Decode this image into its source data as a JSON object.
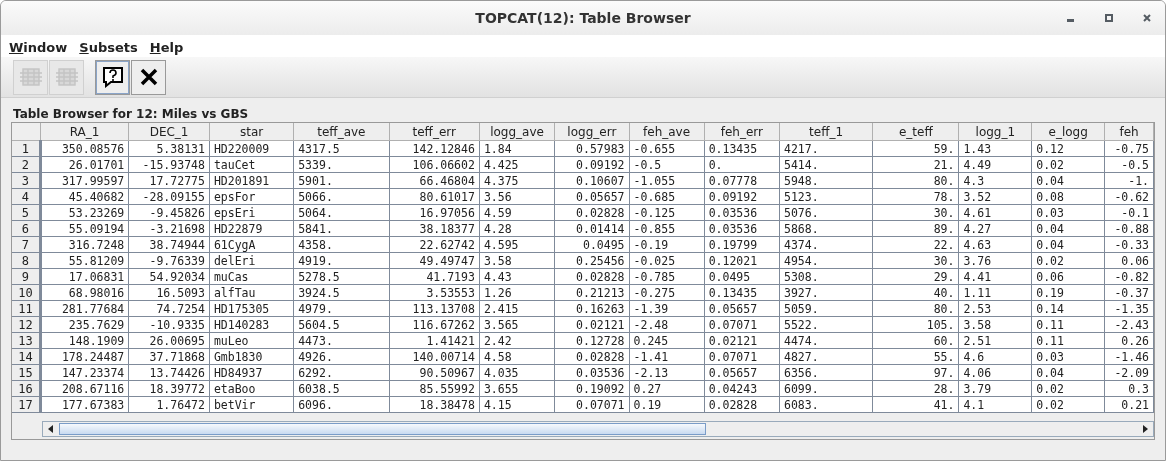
{
  "window": {
    "title": "TOPCAT(12): Table Browser"
  },
  "menu": [
    {
      "label": "Window"
    },
    {
      "label": "Subsets"
    },
    {
      "label": "Help"
    }
  ],
  "toolbar": [
    {
      "kind": "table",
      "disabled": true,
      "focused": false
    },
    {
      "kind": "table",
      "disabled": true,
      "focused": false
    },
    {
      "kind": "help",
      "disabled": false,
      "focused": true
    },
    {
      "kind": "close",
      "disabled": false,
      "focused": false
    }
  ],
  "heading": "Table Browser for 12: Miles vs GBS",
  "table": {
    "columns": [
      "RA_1",
      "DEC_1",
      "star",
      "teff_ave",
      "teff_err",
      "logg_ave",
      "logg_err",
      "feh_ave",
      "feh_err",
      "teff_1",
      "e_teff",
      "logg_1",
      "e_logg",
      "feh"
    ],
    "rows": [
      {
        "number": "1",
        "cells": [
          "350.08576",
          "5.38131",
          "HD220009",
          "4317.5",
          "142.12846",
          "1.84",
          "0.57983",
          "-0.655",
          "0.13435",
          "4217.",
          "59.",
          "1.43",
          "0.12",
          "-0.75"
        ]
      },
      {
        "number": "2",
        "cells": [
          "26.01701",
          "-15.93748",
          "tauCet",
          "5339.",
          "106.06602",
          "4.425",
          "0.09192",
          "-0.5",
          "0.",
          "5414.",
          "21.",
          "4.49",
          "0.02",
          "-0.5"
        ]
      },
      {
        "number": "3",
        "cells": [
          "317.99597",
          "17.72775",
          "HD201891",
          "5901.",
          "66.46804",
          "4.375",
          "0.10607",
          "-1.055",
          "0.07778",
          "5948.",
          "80.",
          "4.3",
          "0.04",
          "-1."
        ]
      },
      {
        "number": "4",
        "cells": [
          "45.40682",
          "-28.09155",
          "epsFor",
          "5066.",
          "80.61017",
          "3.56",
          "0.05657",
          "-0.685",
          "0.09192",
          "5123.",
          "78.",
          "3.52",
          "0.08",
          "-0.62"
        ]
      },
      {
        "number": "5",
        "cells": [
          "53.23269",
          "-9.45826",
          "epsEri",
          "5064.",
          "16.97056",
          "4.59",
          "0.02828",
          "-0.125",
          "0.03536",
          "5076.",
          "30.",
          "4.61",
          "0.03",
          "-0.1"
        ]
      },
      {
        "number": "6",
        "cells": [
          "55.09194",
          "-3.21698",
          "HD22879",
          "5841.",
          "38.18377",
          "4.28",
          "0.01414",
          "-0.855",
          "0.03536",
          "5868.",
          "89.",
          "4.27",
          "0.04",
          "-0.88"
        ]
      },
      {
        "number": "7",
        "cells": [
          "316.7248",
          "38.74944",
          "61CygA",
          "4358.",
          "22.62742",
          "4.595",
          "0.0495",
          "-0.19",
          "0.19799",
          "4374.",
          "22.",
          "4.63",
          "0.04",
          "-0.33"
        ]
      },
      {
        "number": "8",
        "cells": [
          "55.81209",
          "-9.76339",
          "delEri",
          "4919.",
          "49.49747",
          "3.58",
          "0.25456",
          "-0.025",
          "0.12021",
          "4954.",
          "30.",
          "3.76",
          "0.02",
          "0.06"
        ]
      },
      {
        "number": "9",
        "cells": [
          "17.06831",
          "54.92034",
          "muCas",
          "5278.5",
          "41.7193",
          "4.43",
          "0.02828",
          "-0.785",
          "0.0495",
          "5308.",
          "29.",
          "4.41",
          "0.06",
          "-0.82"
        ]
      },
      {
        "number": "10",
        "cells": [
          "68.98016",
          "16.5093",
          "alfTau",
          "3924.5",
          "3.53553",
          "1.26",
          "0.21213",
          "-0.275",
          "0.13435",
          "3927.",
          "40.",
          "1.11",
          "0.19",
          "-0.37"
        ]
      },
      {
        "number": "11",
        "cells": [
          "281.77684",
          "74.7254",
          "HD175305",
          "4979.",
          "113.13708",
          "2.415",
          "0.16263",
          "-1.39",
          "0.05657",
          "5059.",
          "80.",
          "2.53",
          "0.14",
          "-1.35"
        ]
      },
      {
        "number": "12",
        "cells": [
          "235.7629",
          "-10.9335",
          "HD140283",
          "5604.5",
          "116.67262",
          "3.565",
          "0.02121",
          "-2.48",
          "0.07071",
          "5522.",
          "105.",
          "3.58",
          "0.11",
          "-2.43"
        ]
      },
      {
        "number": "13",
        "cells": [
          "148.1909",
          "26.00695",
          "muLeo",
          "4473.",
          "1.41421",
          "2.42",
          "0.12728",
          "0.245",
          "0.02121",
          "4474.",
          "60.",
          "2.51",
          "0.11",
          "0.26"
        ]
      },
      {
        "number": "14",
        "cells": [
          "178.24487",
          "37.71868",
          "Gmb1830",
          "4926.",
          "140.00714",
          "4.58",
          "0.02828",
          "-1.41",
          "0.07071",
          "4827.",
          "55.",
          "4.6",
          "0.03",
          "-1.46"
        ]
      },
      {
        "number": "15",
        "cells": [
          "147.23374",
          "13.74426",
          "HD84937",
          "6292.",
          "90.50967",
          "4.035",
          "0.03536",
          "-2.13",
          "0.05657",
          "6356.",
          "97.",
          "4.06",
          "0.04",
          "-2.09"
        ]
      },
      {
        "number": "16",
        "cells": [
          "208.67116",
          "18.39772",
          "etaBoo",
          "6038.5",
          "85.55992",
          "3.655",
          "0.19092",
          "0.27",
          "0.04243",
          "6099.",
          "28.",
          "3.79",
          "0.02",
          "0.3"
        ]
      },
      {
        "number": "17",
        "cells": [
          "177.67383",
          "1.76472",
          "betVir",
          "6096.",
          "18.38478",
          "4.15",
          "0.07071",
          "0.19",
          "0.02828",
          "6083.",
          "41.",
          "4.1",
          "0.02",
          "0.21"
        ]
      }
    ]
  }
}
